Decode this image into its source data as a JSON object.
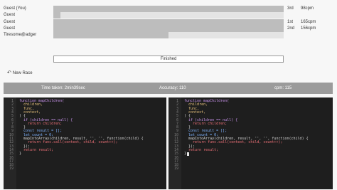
{
  "racers": [
    {
      "name": "Guest (You)",
      "progress": 1.0,
      "place": "3rd",
      "wpm": "98cpm"
    },
    {
      "name": "Guest",
      "progress": 0.03,
      "place": "",
      "wpm": ""
    },
    {
      "name": "Guest",
      "progress": 1.0,
      "place": "1st",
      "wpm": "165cpm"
    },
    {
      "name": "Guest",
      "progress": 1.0,
      "place": "2nd",
      "wpm": "156cpm"
    },
    {
      "name": "Tiresome@adger",
      "progress": 0.5,
      "place": "",
      "wpm": ""
    }
  ],
  "status": {
    "finished_label": "Finished"
  },
  "new_race": {
    "label": "New Race",
    "icon": "undo-arrow-icon"
  },
  "stats": {
    "time": "Time taken: 2min39sec",
    "accuracy": "Accuracy: 110",
    "cpm": "cpm: 115"
  },
  "code": {
    "line_numbers": [
      "1",
      "2",
      "3",
      "4",
      "5",
      "6",
      "7",
      "8",
      "9",
      "10",
      "11",
      "12",
      "13",
      "14",
      "15",
      "16",
      "17",
      "18",
      "19"
    ],
    "lines": [
      "function mapChildren(",
      "  children,",
      "  func,",
      "  context,",
      ") {",
      "  if (children == null) {",
      "    return children;",
      "  }",
      "  const result = [];",
      "  let count = 0;",
      "  mapIntoArray(children, result, '', '', function(child) {",
      "    return func.call(context, child, count++);",
      "  });",
      "  return result;",
      "}"
    ]
  },
  "colors": {
    "track": "#e4e4e4",
    "fill": "#bdbdbd",
    "stats_bar": "#9b9b9b",
    "editor_bg": "#1e1e1e"
  }
}
